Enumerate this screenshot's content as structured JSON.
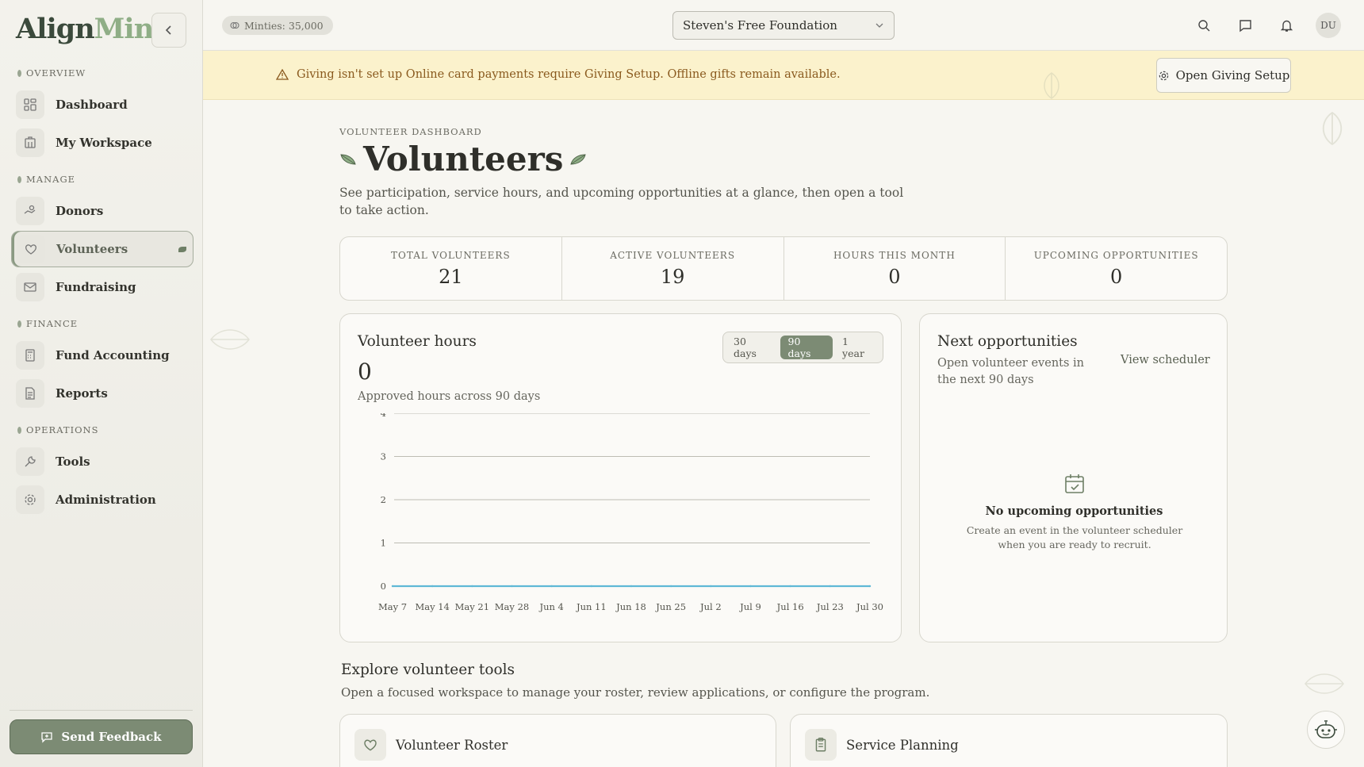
{
  "app": {
    "logo_part1": "Align",
    "logo_part2": "Mint"
  },
  "sidebar": {
    "sections": [
      {
        "label": "OVERVIEW"
      },
      {
        "label": "MANAGE"
      },
      {
        "label": "FINANCE"
      },
      {
        "label": "OPERATIONS"
      }
    ],
    "items": [
      {
        "label": "Dashboard",
        "icon": "dashboard-icon"
      },
      {
        "label": "My Workspace",
        "icon": "building-icon"
      },
      {
        "label": "Donors",
        "icon": "hand-coin-icon"
      },
      {
        "label": "Volunteers",
        "icon": "heart-icon",
        "active": true
      },
      {
        "label": "Fundraising",
        "icon": "mail-icon"
      },
      {
        "label": "Fund Accounting",
        "icon": "calculator-icon"
      },
      {
        "label": "Reports",
        "icon": "document-icon"
      },
      {
        "label": "Tools",
        "icon": "wrench-icon"
      },
      {
        "label": "Administration",
        "icon": "gear-icon"
      }
    ],
    "feedback_label": "Send Feedback"
  },
  "topbar": {
    "minties": "Minties: 35,000",
    "org_selected": "Steven's Free Foundation",
    "avatar_initials": "DU"
  },
  "banner": {
    "text": "Giving isn't set up Online card payments require Giving Setup. Offline gifts remain available.",
    "button_label": "Open Giving Setup"
  },
  "page": {
    "eyebrow": "VOLUNTEER DASHBOARD",
    "title": "Volunteers",
    "subtitle": "See participation, service hours, and upcoming opportunities at a glance, then open a tool to take action."
  },
  "stats": [
    {
      "label": "TOTAL VOLUNTEERS",
      "value": "21"
    },
    {
      "label": "ACTIVE VOLUNTEERS",
      "value": "19"
    },
    {
      "label": "HOURS THIS MONTH",
      "value": "0"
    },
    {
      "label": "UPCOMING OPPORTUNITIES",
      "value": "0"
    }
  ],
  "hours": {
    "title": "Volunteer hours",
    "value": "0",
    "caption": "Approved hours across 90 days",
    "ranges": [
      "30 days",
      "90 days",
      "1 year"
    ],
    "selected_range": "90 days"
  },
  "chart_data": {
    "type": "line",
    "title": "Volunteer hours",
    "categories": [
      "May 7",
      "May 14",
      "May 21",
      "May 28",
      "Jun 4",
      "Jun 11",
      "Jun 18",
      "Jun 25",
      "Jul 2",
      "Jul 9",
      "Jul 16",
      "Jul 23",
      "Jul 30"
    ],
    "series": [
      {
        "values": [
          0,
          0,
          0,
          0,
          0,
          0,
          0,
          0,
          0,
          0,
          0,
          0,
          0
        ]
      }
    ],
    "yticks": [
      "0",
      "1",
      "2",
      "3",
      "4"
    ],
    "ylim": [
      0,
      4
    ],
    "grid": true,
    "line_color": "#5fb8d6"
  },
  "opportunities": {
    "title": "Next opportunities",
    "subtitle": "Open volunteer events in the next 90 days",
    "link": "View scheduler",
    "empty_title": "No upcoming opportunities",
    "empty_text": "Create an event in the volunteer scheduler when you are ready to recruit."
  },
  "explore": {
    "title": "Explore volunteer tools",
    "subtitle": "Open a focused workspace to manage your roster, review applications, or configure the program.",
    "tools": [
      {
        "label": "Volunteer Roster",
        "icon": "heart-icon"
      },
      {
        "label": "Service Planning",
        "icon": "clipboard-icon"
      }
    ]
  },
  "colors": {
    "accent": "#7c8b74",
    "banner_bg": "#fbf2cc",
    "banner_text": "#8a5a1e"
  }
}
